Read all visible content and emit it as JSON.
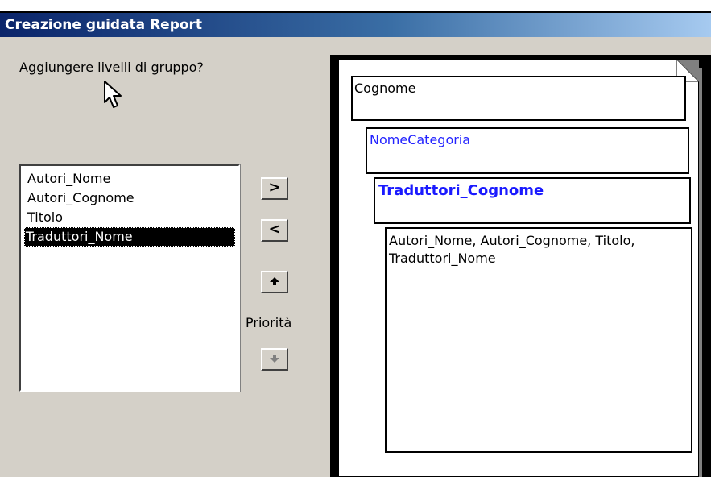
{
  "window": {
    "title": "Creazione guidata Report"
  },
  "prompt": {
    "question": "Aggiungere livelli di gruppo?"
  },
  "fields_list": {
    "items": [
      {
        "label": "Autori_Nome",
        "selected": false
      },
      {
        "label": "Autori_Cognome",
        "selected": false
      },
      {
        "label": "Titolo",
        "selected": false
      },
      {
        "label": "Traduttori_Nome",
        "selected": true
      }
    ]
  },
  "buttons": {
    "add": ">",
    "remove": "<",
    "priority_label": "Priorità"
  },
  "preview": {
    "level1": "Cognome",
    "level2": "NomeCategoria",
    "level3": "Traduttori_Cognome",
    "detail_fields": "Autori_Nome, Autori_Cognome, Titolo, Traduttori_Nome"
  },
  "colors": {
    "dialog_bg": "#d4d0c8",
    "title_gradient_start": "#0a246a",
    "title_gradient_end": "#a6caf0",
    "group_level_text": "#2323ff"
  }
}
